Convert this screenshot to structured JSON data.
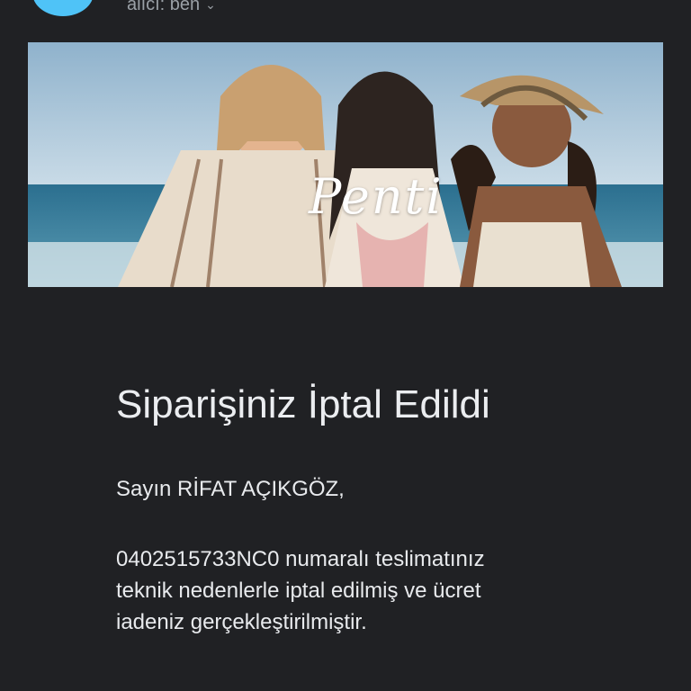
{
  "header": {
    "recipient_label": "alıcı: ben",
    "expand_icon": "chevron-down-icon"
  },
  "banner": {
    "brand": "Penti"
  },
  "email": {
    "title": "Siparişiniz İptal Edildi",
    "greeting": "Sayın RİFAT AÇIKGÖZ,",
    "body_lines": [
      "0402515733NC0 numaralı teslimatınız",
      "teknik nedenlerle iptal edilmiş ve ücret",
      "iadeniz gerçekleştirilmiştir."
    ]
  },
  "colors": {
    "background": "#202124",
    "avatar": "#4fc3f7",
    "text": "#e8eaed",
    "muted": "#9aa0a6"
  }
}
